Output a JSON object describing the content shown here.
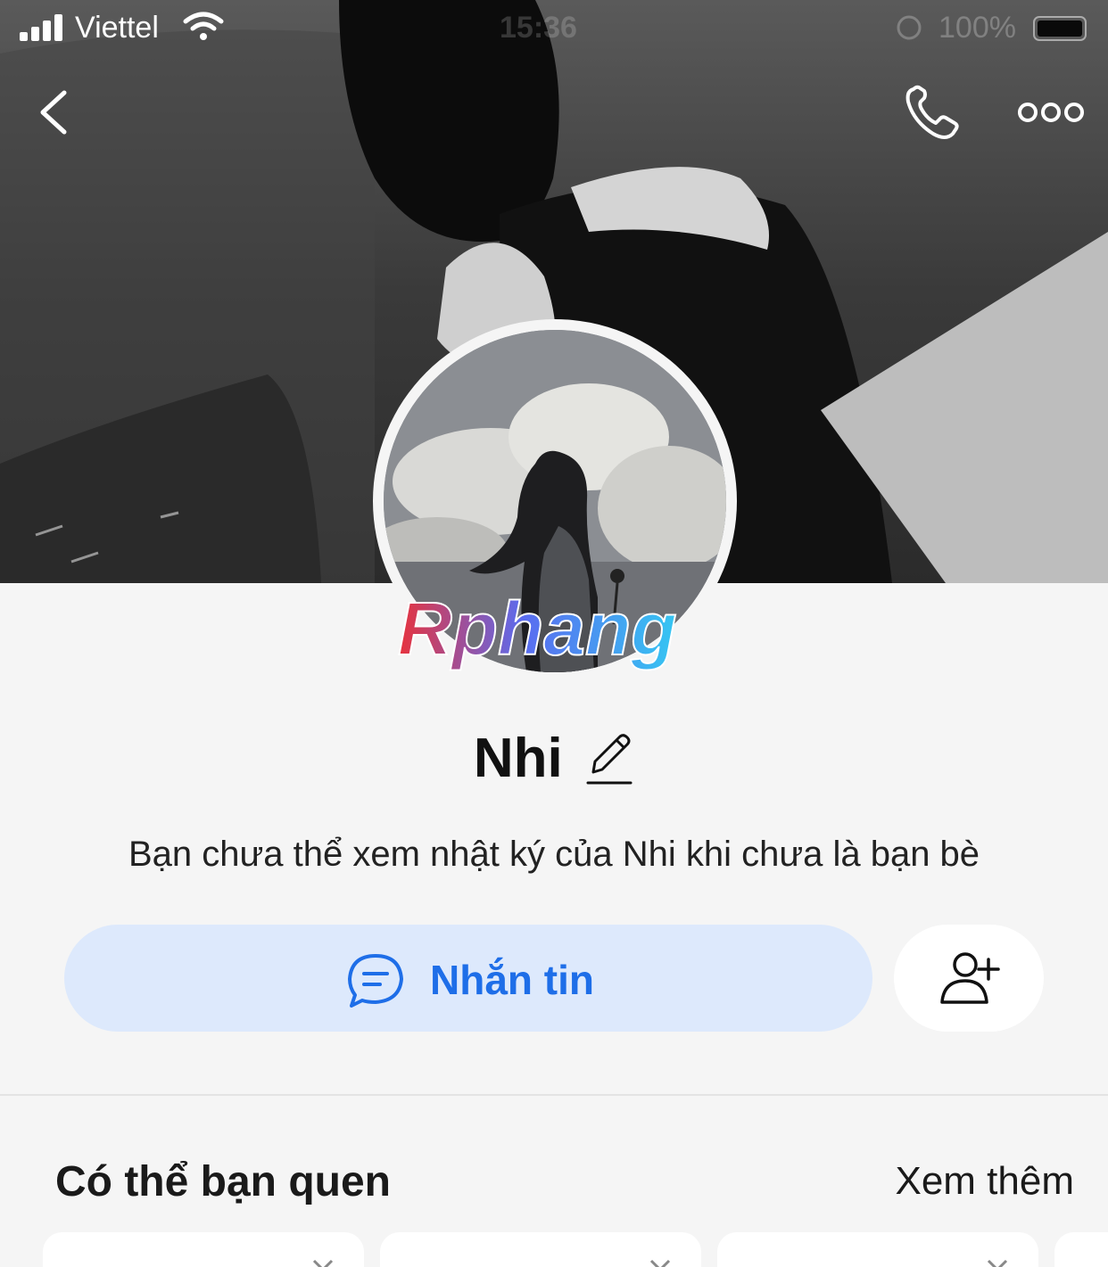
{
  "status_bar": {
    "carrier": "Viettel",
    "time": "15:36",
    "battery": "100%"
  },
  "profile": {
    "name": "Nhi",
    "notice": "Bạn chưa thể xem nhật ký của Nhi khi chưa là bạn bè"
  },
  "actions": {
    "message_label": "Nhắn tin"
  },
  "suggestions": {
    "title": "Có thể bạn quen",
    "see_more": "Xem thêm"
  },
  "watermark": "Rphang",
  "colors": {
    "accent": "#1e6ee8",
    "message_button_bg": "#dde9fc",
    "page_bg": "#f5f5f5"
  }
}
